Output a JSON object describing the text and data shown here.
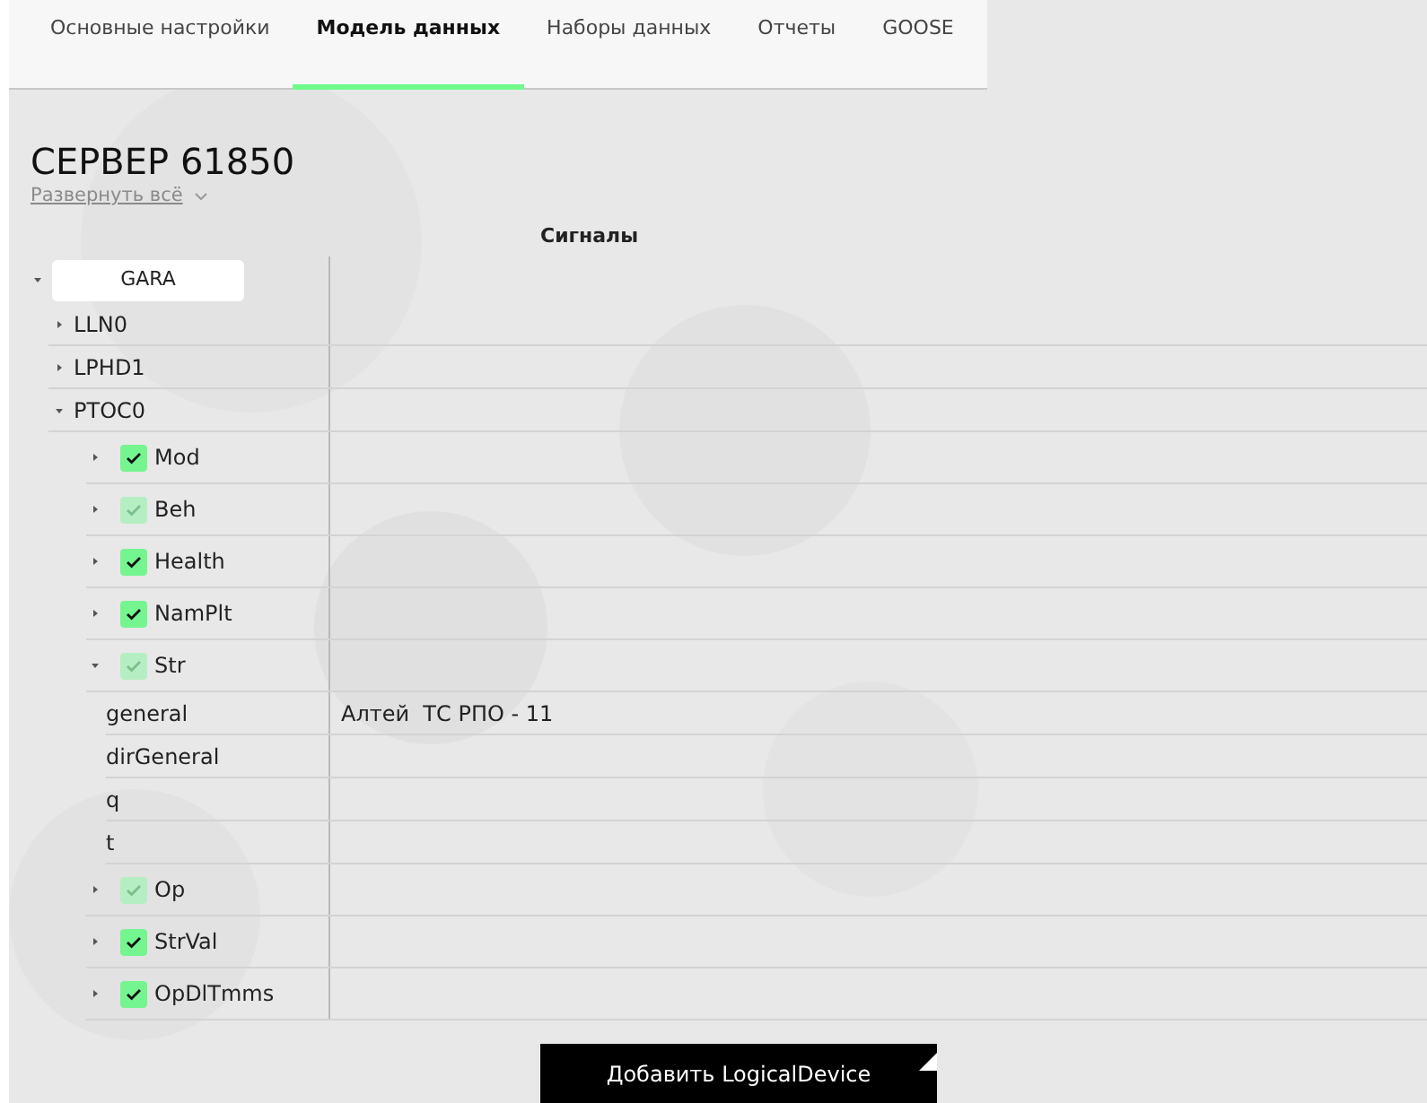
{
  "tabs": [
    {
      "label": "Основные настройки",
      "selected": false
    },
    {
      "label": "Модель данных",
      "selected": true
    },
    {
      "label": "Наборы данных",
      "selected": false
    },
    {
      "label": "Отчеты",
      "selected": false
    },
    {
      "label": "GOOSE",
      "selected": false
    }
  ],
  "server": {
    "title": "СЕРВЕР 61850",
    "expand_all": "Развернуть всё"
  },
  "signals_header": "Сигналы",
  "tree": {
    "label": "GARA",
    "expanded": true,
    "children": [
      {
        "label": "LLN0",
        "expanded": false
      },
      {
        "label": "LPHD1",
        "expanded": false
      },
      {
        "label": "PTOC0",
        "expanded": true,
        "children": [
          {
            "label": "Mod",
            "expanded": false,
            "checked": true,
            "partial": false
          },
          {
            "label": "Beh",
            "expanded": false,
            "checked": true,
            "partial": true
          },
          {
            "label": "Health",
            "expanded": false,
            "checked": true,
            "partial": false
          },
          {
            "label": "NamPlt",
            "expanded": false,
            "checked": true,
            "partial": false
          },
          {
            "label": "Str",
            "expanded": true,
            "checked": true,
            "partial": true,
            "children": [
              {
                "label": "general",
                "signal": "Алтей  ТС РПО - 11"
              },
              {
                "label": "dirGeneral"
              },
              {
                "label": "q"
              },
              {
                "label": "t"
              }
            ]
          },
          {
            "label": "Op",
            "expanded": false,
            "checked": true,
            "partial": true
          },
          {
            "label": "StrVal",
            "expanded": false,
            "checked": true,
            "partial": false
          },
          {
            "label": "OpDlTmms",
            "expanded": false,
            "checked": true,
            "partial": false
          }
        ]
      }
    ]
  },
  "add_button": "Добавить LogicalDevice"
}
